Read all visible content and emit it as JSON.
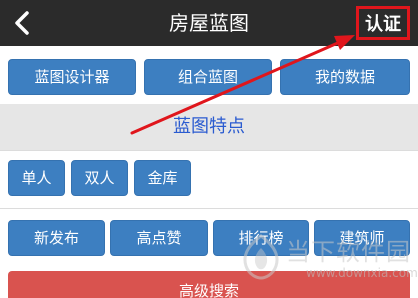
{
  "header": {
    "title": "房屋蓝图",
    "auth_label": "认证",
    "back_icon": "chevron-left-icon",
    "highlight_color": "#e0161c"
  },
  "top_buttons": [
    "蓝图设计器",
    "组合蓝图",
    "我的数据"
  ],
  "features": {
    "title": "蓝图特点"
  },
  "tag_buttons": [
    "单人",
    "双人",
    "金库"
  ],
  "list_buttons": [
    "新发布",
    "高点赞",
    "排行榜",
    "建筑师"
  ],
  "advanced_search_label": "高级搜索",
  "watermark": {
    "name": "当下软件园",
    "url": "www.downxia.com"
  },
  "colors": {
    "header_bg": "#2b2b2b",
    "button_blue": "#3d7fc1",
    "advanced_red": "#d9534f",
    "features_title": "#2a5bd0",
    "annotation_red": "#e0161c"
  }
}
